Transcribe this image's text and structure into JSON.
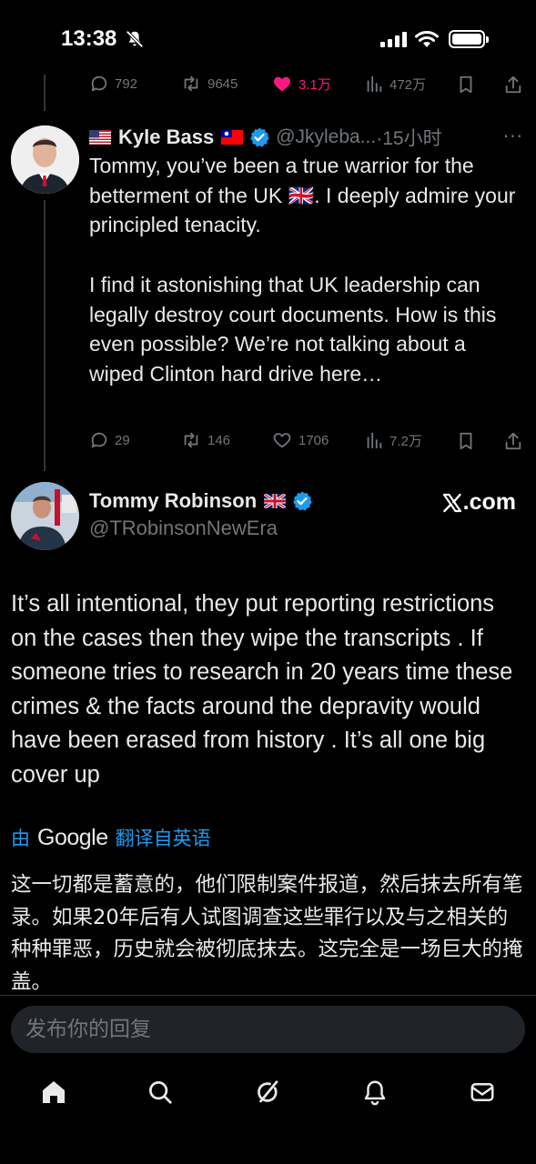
{
  "status_bar": {
    "time": "13:38"
  },
  "top_actions": {
    "replies": "792",
    "reposts": "9645",
    "likes": "3.1万",
    "views": "472万"
  },
  "reply_tweet": {
    "name": "Kyle Bass",
    "handle": "@Jkyleba...",
    "time": "·15小时",
    "text": "Tommy, you’ve been a true warrior for the betterment of the UK 🇬🇧. I deeply admire your principled tenacity.\n\nI find it astonishing that UK leadership can legally destroy court documents. How is this even possible? We’re not talking about a wiped Clinton hard drive here…",
    "actions": {
      "replies": "29",
      "reposts": "146",
      "likes": "1706",
      "views": "7.2万"
    }
  },
  "main_tweet": {
    "name": "Tommy Robinson",
    "handle": "@TRobinsonNewEra",
    "source": ".com",
    "text": "It’s all intentional, they put reporting restrictions on the cases then they wipe the transcripts . If someone tries to research in 20 years time these crimes & the facts around the depravity would have been erased from history . It’s all one big cover up",
    "translate_prefix": "由",
    "translate_brand": "Google",
    "translate_suffix": "翻译自英语",
    "translated_text": "这一切都是蓄意的，他们限制案件报道，然后抹去所有笔录。如果20年后有人试图调查这些罪行以及与之相关的种种罪恶，历史就会被彻底抹去。这完全是一场巨大的掩盖。"
  },
  "reply_input": {
    "placeholder": "发布你的回复"
  },
  "tabs": [
    "home-icon",
    "search-icon",
    "grok-icon",
    "notifications-icon",
    "messages-icon"
  ],
  "colors": {
    "like": "#f91880",
    "verified": "#1d9bf0",
    "muted": "#71767b",
    "text": "#e7e9ea"
  }
}
